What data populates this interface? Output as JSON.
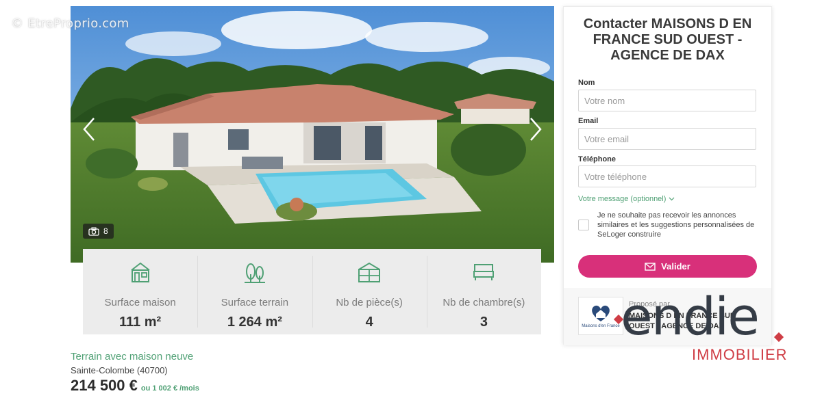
{
  "watermark": "© EtreProprio.com",
  "gallery": {
    "photo_count": "8",
    "prev_icon": "chevron-left-icon",
    "next_icon": "chevron-right-icon",
    "camera_icon": "camera-icon"
  },
  "features": [
    {
      "label": "Surface maison",
      "value": "111 m²",
      "icon": "house-icon"
    },
    {
      "label": "Surface terrain",
      "value": "1 264 m²",
      "icon": "trees-icon"
    },
    {
      "label": "Nb de pièce(s)",
      "value": "4",
      "icon": "floorplan-icon"
    },
    {
      "label": "Nb de chambre(s)",
      "value": "3",
      "icon": "bed-icon"
    }
  ],
  "listing": {
    "type": "Terrain avec maison neuve",
    "location": "Sainte-Colombe (40700)",
    "price": "214 500 €",
    "monthly": "ou 1 002 € /mois"
  },
  "contact": {
    "title": "Contacter MAISONS D EN FRANCE SUD OUEST - AGENCE DE DAX",
    "name_label": "Nom",
    "name_placeholder": "Votre nom",
    "email_label": "Email",
    "email_placeholder": "Votre email",
    "phone_label": "Téléphone",
    "phone_placeholder": "Votre téléphone",
    "message_toggle": "Votre message (optionnel)",
    "consent": "Je ne souhaite pas recevoir les annonces similaires et les suggestions personnalisées de SeLoger construire",
    "submit_label": "Valider",
    "proposed_by": "Proposé par",
    "agency_name": "MAISONS D EN FRANCE SUD OUEST - AGENCE DE DAX",
    "agency_logo_text": "Maisons d'en France"
  },
  "brand": {
    "name": "endie",
    "tagline": "IMMOBILIER"
  },
  "colors": {
    "accent_green": "#4fa074",
    "submit_pink": "#d8307a",
    "brand_red": "#cf3d45"
  }
}
